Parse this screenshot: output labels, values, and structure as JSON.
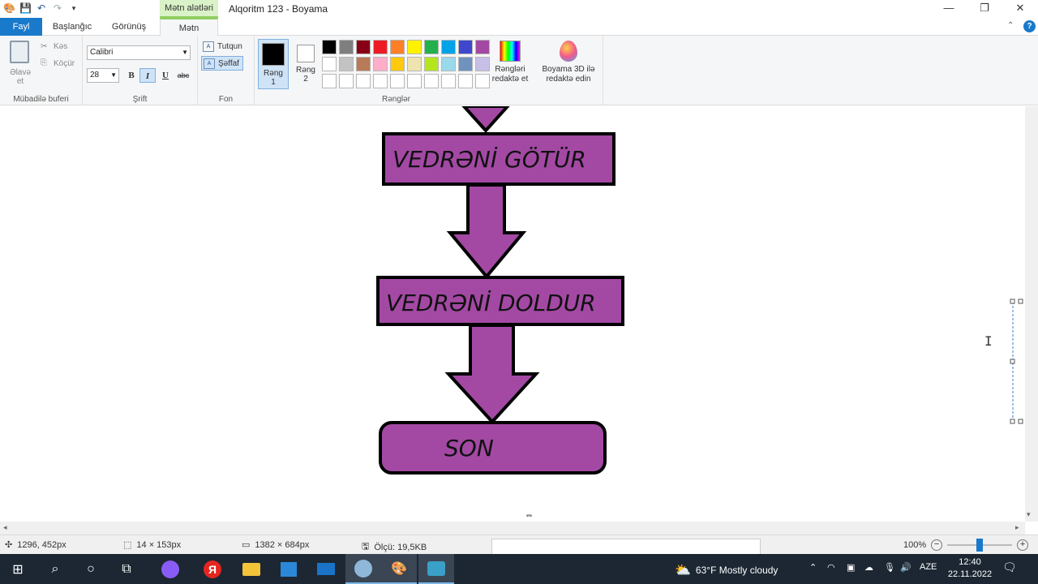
{
  "window": {
    "title": "Alqoritm 123 - Boyama",
    "context_tab": "Mətn alətləri",
    "minimize": "—",
    "restore": "❐",
    "close": "✕"
  },
  "tabs": {
    "file": "Fayl",
    "home": "Başlanğıc",
    "view": "Görünüş",
    "text": "Mətn"
  },
  "ribbon": {
    "clipboard": {
      "paste": "Əlavə et",
      "cut": "Kəs",
      "copy": "Köçür",
      "label": "Mübadilə buferi"
    },
    "font": {
      "family": "Calibri",
      "size": "28",
      "bold": "B",
      "italic": "I",
      "underline": "U",
      "strike": "abc",
      "label": "Şrift"
    },
    "background": {
      "opaque": "Tutqun",
      "transparent": "Şəffaf",
      "label": "Fon"
    },
    "colors": {
      "color1": "Rəng 1",
      "color2": "Rəng 2",
      "edit_colors": "Rəngləri redaktə et",
      "paint3d": "Boyama 3D ilə redaktə edin",
      "label": "Rənglər",
      "color1_value": "#000000",
      "color2_value": "#ffffff",
      "palette": [
        "#000000",
        "#7f7f7f",
        "#880015",
        "#ed1c24",
        "#ff7f27",
        "#fff200",
        "#22b14c",
        "#00a2e8",
        "#3f48cc",
        "#a349a4",
        "#ffffff",
        "#c3c3c3",
        "#b97a57",
        "#ffaec9",
        "#ffc90e",
        "#efe4b0",
        "#b5e61d",
        "#99d9ea",
        "#7092be",
        "#c8bfe7",
        "#ffffff",
        "#ffffff",
        "#ffffff",
        "#ffffff",
        "#ffffff",
        "#ffffff",
        "#ffffff",
        "#ffffff",
        "#ffffff",
        "#ffffff"
      ]
    }
  },
  "flowchart": {
    "fill": "#a349a4",
    "steps": [
      "VEDRƏNİ GÖTÜR",
      "VEDRƏNİ DOLDUR"
    ],
    "end": "SON"
  },
  "status": {
    "cursor": "1296, 452px",
    "selection": "14 × 153px",
    "image_size": "1382 × 684px",
    "file_size": "Ölçü: 19,5KB",
    "zoom": "100%"
  },
  "taskbar": {
    "weather": "63°F  Mostly cloudy",
    "lang": "AZE",
    "time": "12:40",
    "date": "22.11.2022"
  }
}
